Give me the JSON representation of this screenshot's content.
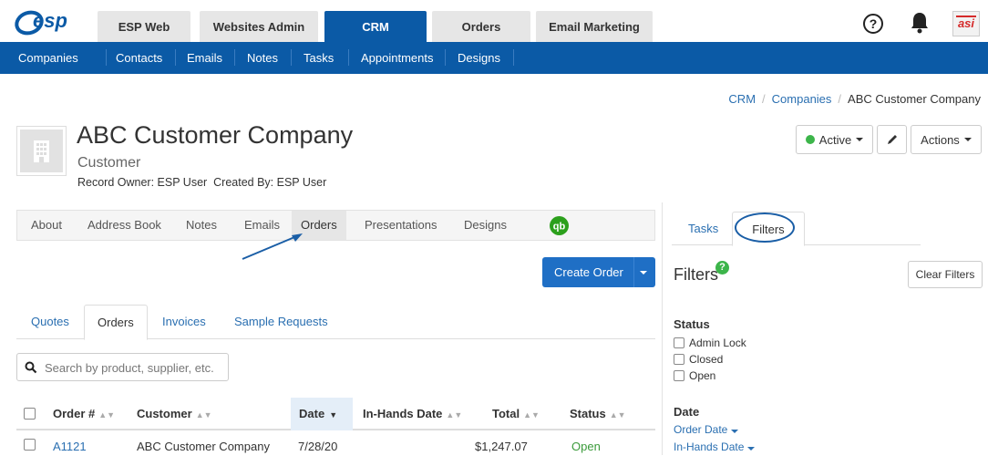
{
  "app_tabs": [
    "ESP Web",
    "Websites Admin",
    "CRM",
    "Orders",
    "Email Marketing"
  ],
  "logo": {
    "text": "esp",
    "asi_text": "asi"
  },
  "subnav": [
    "Companies",
    "Contacts",
    "Emails",
    "Notes",
    "Tasks",
    "Appointments",
    "Designs"
  ],
  "breadcrumb": {
    "crm": "CRM",
    "companies": "Companies",
    "current": "ABC Customer Company"
  },
  "company": {
    "name": "ABC Customer Company",
    "type": "Customer",
    "record_owner": "Record Owner: ESP User  Created By: ESP User"
  },
  "header_actions": {
    "status": "Active",
    "actions": "Actions"
  },
  "record_tabs": [
    "About",
    "Address Book",
    "Notes",
    "Emails",
    "Orders",
    "Presentations",
    "Designs"
  ],
  "qb_icon_text": "qb",
  "create_order": "Create Order",
  "order_tabs": [
    "Quotes",
    "Orders",
    "Invoices",
    "Sample Requests"
  ],
  "search": {
    "placeholder": "Search by product, supplier, etc."
  },
  "table": {
    "columns": [
      "Order #",
      "Customer",
      "Date",
      "In-Hands Date",
      "Total",
      "Status"
    ],
    "rows": [
      {
        "order": "A1121",
        "customer": "ABC Customer Company",
        "date": "7/28/20",
        "in_hands": "",
        "total": "$1,247.07",
        "status": "Open"
      }
    ]
  },
  "right_panel": {
    "tabs": [
      "Tasks",
      "Filters"
    ],
    "heading": "Filters",
    "info_badge": "?",
    "clear_filters": "Clear Filters",
    "status_title": "Status",
    "status_options": [
      "Admin Lock",
      "Closed",
      "Open"
    ],
    "date_title": "Date",
    "date_options": [
      "Order Date",
      "In-Hands Date"
    ]
  },
  "colors": {
    "primary": "#0b5aa6",
    "button": "#1f6fc5",
    "active_green": "#3cb54a",
    "link": "#2a6fb1"
  }
}
